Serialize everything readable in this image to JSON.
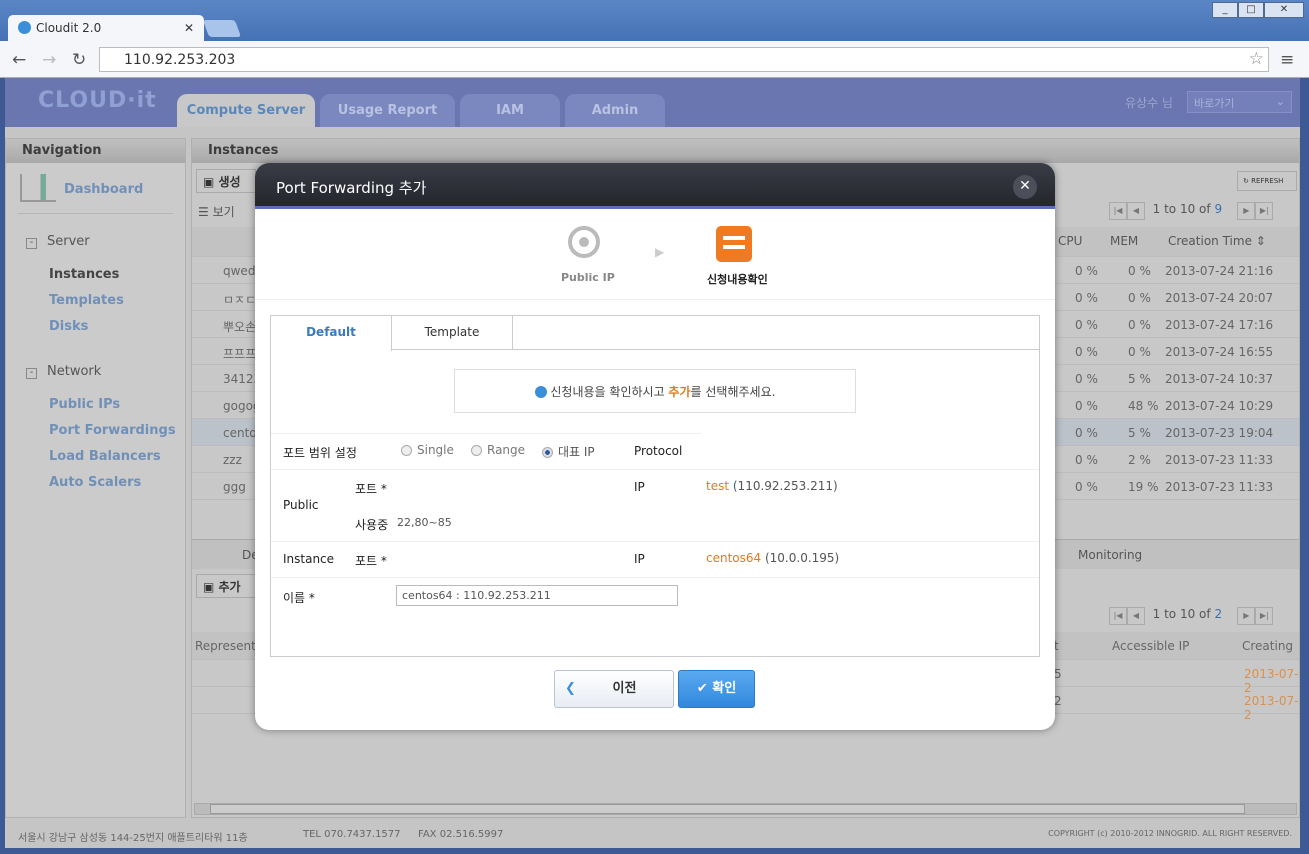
{
  "browser": {
    "tab_title": "Cloudit 2.0",
    "url": "110.92.253.203"
  },
  "header": {
    "logo": "cloud it",
    "tabs": [
      "Compute Server",
      "Usage Report",
      "IAM",
      "Admin"
    ],
    "user": "유상수 님",
    "shortcut": "바로가기"
  },
  "sidebar": {
    "title": "Navigation",
    "dashboard": "Dashboard",
    "groups": [
      {
        "label": "Server",
        "items": [
          "Instances",
          "Templates",
          "Disks"
        ]
      },
      {
        "label": "Network",
        "items": [
          "Public IPs",
          "Port Forwardings",
          "Load Balancers",
          "Auto Scalers"
        ]
      }
    ]
  },
  "main": {
    "title": "Instances",
    "create": "생성",
    "view": "보기",
    "refresh": "REFRESH",
    "pager": {
      "text": "1 to 10 of",
      "total": "9"
    },
    "columns": {
      "cpu": "CPU",
      "mem": "MEM",
      "time": "Creation Time"
    },
    "rows": [
      {
        "name": "qwed",
        "cpu": "0 %",
        "mem": "0 %",
        "time": "2013-07-24 21:16"
      },
      {
        "name": "ㅁㅈㄷ",
        "cpu": "0 %",
        "mem": "0 %",
        "time": "2013-07-24 20:07"
      },
      {
        "name": "뿌오손",
        "cpu": "0 %",
        "mem": "0 %",
        "time": "2013-07-24 17:16"
      },
      {
        "name": "프프프",
        "cpu": "0 %",
        "mem": "0 %",
        "time": "2013-07-24 16:55"
      },
      {
        "name": "34123",
        "cpu": "0 %",
        "mem": "5 %",
        "time": "2013-07-24 10:37"
      },
      {
        "name": "gogog",
        "cpu": "0 %",
        "mem": "48 %",
        "time": "2013-07-24 10:29"
      },
      {
        "name": "centos",
        "cpu": "0 %",
        "mem": "5 %",
        "time": "2013-07-23 19:04"
      },
      {
        "name": "zzz",
        "cpu": "0 %",
        "mem": "2 %",
        "time": "2013-07-23 11:33"
      },
      {
        "name": "ggg",
        "cpu": "0 %",
        "mem": "19 %",
        "time": "2013-07-23 11:33"
      }
    ],
    "lower": {
      "tab_de": "De",
      "tab_monitoring": "Monitoring",
      "add": "추가",
      "pager": {
        "text": "1 to 10 of",
        "total": "2"
      },
      "col_rep": "Representa",
      "col_t": "t",
      "col_ip": "Accessible IP",
      "col_creating": "Creating",
      "rows": [
        {
          "t": "5",
          "date": "2013-07-2"
        },
        {
          "t": "2",
          "date": "2013-07-2"
        }
      ]
    }
  },
  "footer": {
    "address": "서울시 강남구 삼성동 144-25번지 애플트리타워 11층",
    "tel": "TEL 070.7437.1577",
    "fax": "FAX 02.516.5997",
    "copyright": "COPYRIGHT (c) 2010-2012 INNOGRID. ALL RIGHT RESERVED."
  },
  "modal": {
    "title": "Port Forwarding 추가",
    "steps": [
      "Public IP",
      "신청내용확인"
    ],
    "tabs": [
      "Default",
      "Template"
    ],
    "notice": {
      "pre": "신청내용을 확인하시고 ",
      "em": "추가",
      "post": "를 선택해주세요."
    },
    "form": {
      "range_label": "포트 범위 설정",
      "options": [
        "Single",
        "Range",
        "대표 IP"
      ],
      "selected": "대표 IP",
      "protocol": "Protocol",
      "public": "Public",
      "port": "포트 *",
      "ip": "IP",
      "public_ip_name": "test",
      "public_ip": "(110.92.253.211)",
      "in_use_label": "사용중",
      "in_use": "22,80~85",
      "instance": "Instance",
      "instance_name": "centos64",
      "instance_ip": "(10.0.0.195)",
      "name_label": "이름 *",
      "name_value": "centos64 : 110.92.253.211"
    },
    "prev": "이전",
    "ok": "확인"
  }
}
